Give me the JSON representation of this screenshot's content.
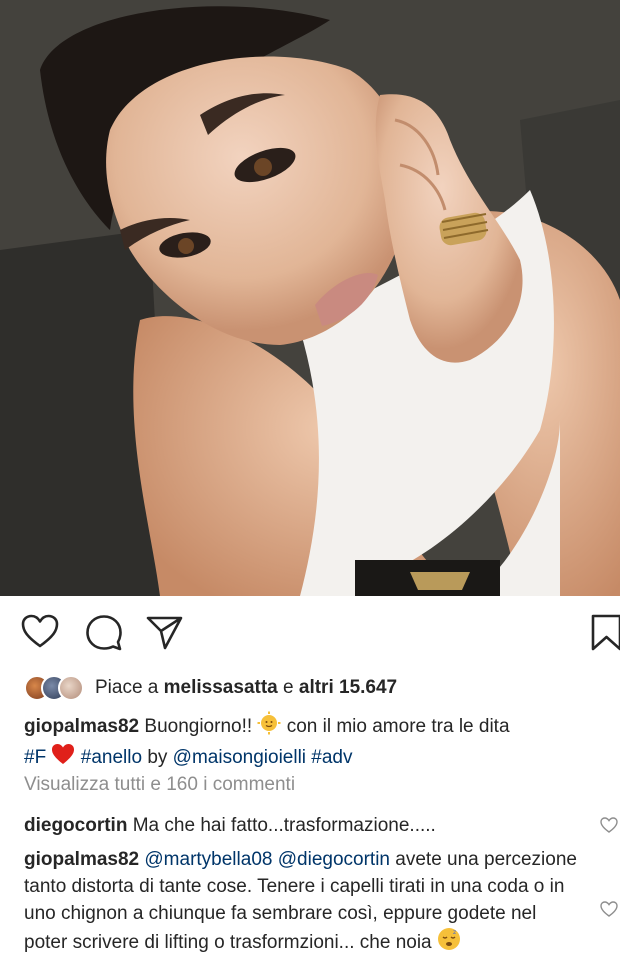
{
  "post": {
    "actions": {
      "like": "heart-icon",
      "comment": "comment-icon",
      "share": "send-icon",
      "save": "bookmark-icon"
    },
    "likes": {
      "prefix": "Piace a",
      "user": "melissasatta",
      "connector": "e",
      "others": "altri 15.647"
    },
    "caption": {
      "username": "giopalmas82",
      "text_1": "Buongiorno!!",
      "text_2": "con il mio amore tra le dita",
      "tag_f": "#F",
      "tag_anello": "#anello",
      "by": "by",
      "mention": "@maisongioielli",
      "tag_adv": "#adv"
    },
    "view_all": "Visualizza tutti e 160 i commenti",
    "comments": [
      {
        "username": "diegocortin",
        "text": "Ma che hai fatto...trasformazione....."
      },
      {
        "username": "giopalmas82",
        "mention_1": "@martybella08",
        "mention_2": "@diegocortin",
        "text": "avete una percezione tanto distorta di tante cose. Tenere i capelli tirati in una coda o in uno chignon a chiunque fa sembrare così, eppure godete nel poter scrivere di lifting o trasformzioni... che noia"
      }
    ]
  },
  "colors": {
    "text": "#262626",
    "muted": "#8e8e8e",
    "link": "#003569",
    "heart_red": "#e0201a"
  }
}
